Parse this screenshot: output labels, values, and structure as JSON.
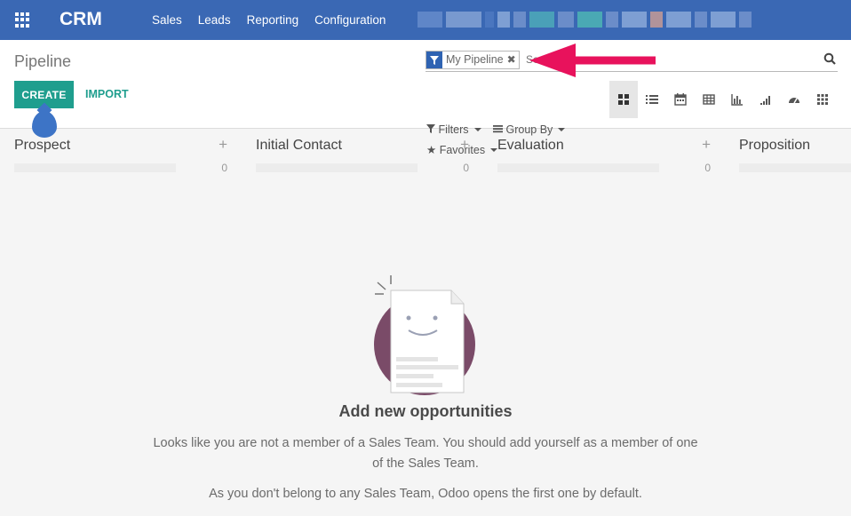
{
  "navbar": {
    "app_name": "CRM",
    "menu": [
      "Sales",
      "Leads",
      "Reporting",
      "Configuration"
    ]
  },
  "control_panel": {
    "breadcrumb": "Pipeline",
    "create_label": "CREATE",
    "import_label": "IMPORT",
    "search": {
      "facet_label": "My Pipeline",
      "placeholder": "Search..."
    },
    "filters_label": "Filters",
    "group_by_label": "Group By",
    "favorites_label": "Favorites",
    "views": [
      "kanban-icon",
      "list-icon",
      "calendar-icon",
      "pivot-icon",
      "graph-icon",
      "cohort-icon",
      "dashboard-icon",
      "grid-icon"
    ]
  },
  "kanban": {
    "columns": [
      {
        "title": "Prospect",
        "count": "0"
      },
      {
        "title": "Initial Contact",
        "count": "0"
      },
      {
        "title": "Evaluation",
        "count": "0"
      },
      {
        "title": "Proposition",
        "count": ""
      }
    ]
  },
  "empty_state": {
    "title": "Add new opportunities",
    "text1": "Looks like you are not a member of a Sales Team. You should add yourself as a member of one of the Sales Team.",
    "text2": "As you don't belong to any Sales Team, Odoo opens the first one by default."
  },
  "colors": {
    "navbar": "#3a68b4",
    "primary_button": "#1f9e8e",
    "annotation_arrow": "#e8125c"
  }
}
